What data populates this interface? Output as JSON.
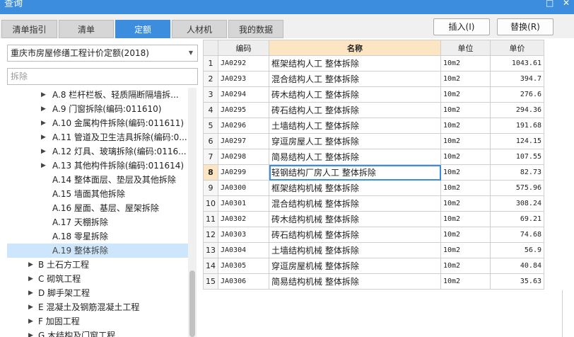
{
  "window": {
    "title": "查询",
    "restore_glyph": "□",
    "close_glyph": "✕"
  },
  "tabs": [
    {
      "label": "清单指引",
      "active": false
    },
    {
      "label": "清单",
      "active": false
    },
    {
      "label": "定额",
      "active": true
    },
    {
      "label": "人材机",
      "active": false
    },
    {
      "label": "我的数据",
      "active": false
    }
  ],
  "actions": {
    "insert": "插入(I)",
    "replace": "替换(R)"
  },
  "quota_library": {
    "selected": "重庆市房屋修缮工程计价定额(2018)"
  },
  "search": {
    "value": "拆除"
  },
  "tree": [
    {
      "label": "A.8 栏杆栏板、轻质隔断隔墙拆...",
      "caret": "▶",
      "level": 3,
      "selected": false
    },
    {
      "label": "A.9 门窗拆除(编码:011610)",
      "caret": "▶",
      "level": 3,
      "selected": false
    },
    {
      "label": "A.10 金属构件拆除(编码:011611)",
      "caret": "▶",
      "level": 3,
      "selected": false
    },
    {
      "label": "A.11 管道及卫生洁具拆除(编码:0...",
      "caret": "▶",
      "level": 3,
      "selected": false
    },
    {
      "label": "A.12 灯具、玻璃拆除(编码:0116...",
      "caret": "▶",
      "level": 3,
      "selected": false
    },
    {
      "label": "A.13 其他构件拆除(编码:011614)",
      "caret": "▶",
      "level": 3,
      "selected": false
    },
    {
      "label": "A.14 整体面层、垫层及其他拆除",
      "caret": "",
      "level": 3,
      "selected": false
    },
    {
      "label": "A.15 墙面其他拆除",
      "caret": "",
      "level": 3,
      "selected": false
    },
    {
      "label": "A.16 屋面、基层、屋架拆除",
      "caret": "",
      "level": 3,
      "selected": false
    },
    {
      "label": "A.17 天棚拆除",
      "caret": "",
      "level": 3,
      "selected": false
    },
    {
      "label": "A.18 零星拆除",
      "caret": "",
      "level": 3,
      "selected": false
    },
    {
      "label": "A.19 整体拆除",
      "caret": "",
      "level": 3,
      "selected": true
    },
    {
      "label": "B 土石方工程",
      "caret": "▶",
      "level": 2,
      "selected": false
    },
    {
      "label": "C 砌筑工程",
      "caret": "▶",
      "level": 2,
      "selected": false
    },
    {
      "label": "D 脚手架工程",
      "caret": "▶",
      "level": 2,
      "selected": false
    },
    {
      "label": "E 混凝土及钢筋混凝土工程",
      "caret": "▶",
      "level": 2,
      "selected": false
    },
    {
      "label": "F 加固工程",
      "caret": "▶",
      "level": 2,
      "selected": false
    },
    {
      "label": "G 木结构及门窗工程",
      "caret": "▶",
      "level": 2,
      "selected": false
    }
  ],
  "grid": {
    "headers": {
      "code": "编码",
      "name": "名称",
      "unit": "单位",
      "price": "单价"
    },
    "current_row": 8,
    "rows": [
      {
        "no": "1",
        "code": "JA0292",
        "name": "框架结构人工 整体拆除",
        "unit": "10m2",
        "price": "1043.61"
      },
      {
        "no": "2",
        "code": "JA0293",
        "name": "混合结构人工 整体拆除",
        "unit": "10m2",
        "price": "394.7"
      },
      {
        "no": "3",
        "code": "JA0294",
        "name": "砖木结构人工 整体拆除",
        "unit": "10m2",
        "price": "276.6"
      },
      {
        "no": "4",
        "code": "JA0295",
        "name": "砖石结构人工 整体拆除",
        "unit": "10m2",
        "price": "294.36"
      },
      {
        "no": "5",
        "code": "JA0296",
        "name": "土墙结构人工 整体拆除",
        "unit": "10m2",
        "price": "191.68"
      },
      {
        "no": "6",
        "code": "JA0297",
        "name": "穿逗房屋人工 整体拆除",
        "unit": "10m2",
        "price": "124.15"
      },
      {
        "no": "7",
        "code": "JA0298",
        "name": "简易结构人工 整体拆除",
        "unit": "10m2",
        "price": "107.55"
      },
      {
        "no": "8",
        "code": "JA0299",
        "name": "轻钢结构厂房人工 整体拆除",
        "unit": "10m2",
        "price": "82.73"
      },
      {
        "no": "9",
        "code": "JA0300",
        "name": "框架结构机械 整体拆除",
        "unit": "10m2",
        "price": "575.96"
      },
      {
        "no": "10",
        "code": "JA0301",
        "name": "混合结构机械 整体拆除",
        "unit": "10m2",
        "price": "308.24"
      },
      {
        "no": "11",
        "code": "JA0302",
        "name": "砖木结构机械 整体拆除",
        "unit": "10m2",
        "price": "69.21"
      },
      {
        "no": "12",
        "code": "JA0303",
        "name": "砖石结构机械 整体拆除",
        "unit": "10m2",
        "price": "74.68"
      },
      {
        "no": "13",
        "code": "JA0304",
        "name": "土墙结构机械 整体拆除",
        "unit": "10m2",
        "price": "56.9"
      },
      {
        "no": "14",
        "code": "JA0305",
        "name": "穿逗房屋机械 整体拆除",
        "unit": "10m2",
        "price": "40.84"
      },
      {
        "no": "15",
        "code": "JA0306",
        "name": "简易结构机械 整体拆除",
        "unit": "10m2",
        "price": "35.63"
      }
    ]
  },
  "colors": {
    "accent": "#3c8dde",
    "selected_row": "#cde6fb",
    "header_highlight": "#fbe5c2"
  }
}
